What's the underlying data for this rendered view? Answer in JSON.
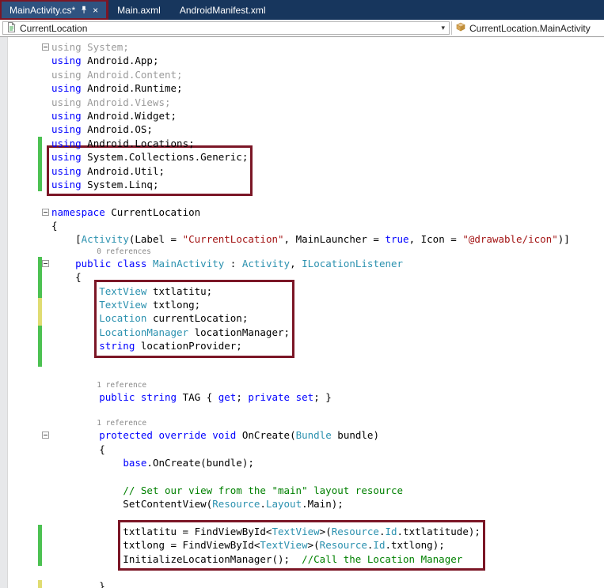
{
  "tabs": [
    {
      "label": "MainActivity.cs*",
      "active": true
    },
    {
      "label": "Main.axml",
      "active": false
    },
    {
      "label": "AndroidManifest.xml",
      "active": false
    }
  ],
  "navbar": {
    "scope": "CurrentLocation",
    "member": "CurrentLocation.MainActivity"
  },
  "colors": {
    "keyword": "#0000ff",
    "type": "#2b91af",
    "string": "#a31515",
    "comment": "#008000",
    "inactive_using": "#9b9b9b",
    "codelens": "#8a8a8a",
    "annotation_box": "#7b1626",
    "change_saved_green": "#4cc152",
    "change_unsaved_yellow": "#e0dc72",
    "tabbar_bg": "#17365d",
    "active_tab_bg": "#2f5380"
  },
  "icons": {
    "pin": "pin-icon",
    "close": "close-icon",
    "chevron": "chevron-down-icon",
    "document": "document-icon",
    "class": "class-icon"
  },
  "editor": {
    "box_groups": {
      "1": {
        "indent": 0
      },
      "2": {
        "indent": 8
      },
      "3": {
        "indent": 12
      }
    },
    "lines": [
      {
        "fold": true,
        "seg": [
          [
            "gy",
            "using System;"
          ]
        ]
      },
      {
        "seg": [
          [
            "kw",
            "using"
          ],
          [
            "pl",
            " Android.App;"
          ]
        ]
      },
      {
        "seg": [
          [
            "gy",
            "using Android.Content;"
          ]
        ]
      },
      {
        "seg": [
          [
            "kw",
            "using"
          ],
          [
            "pl",
            " Android.Runtime;"
          ]
        ]
      },
      {
        "seg": [
          [
            "gy",
            "using Android.Views;"
          ]
        ]
      },
      {
        "seg": [
          [
            "kw",
            "using"
          ],
          [
            "pl",
            " Android.Widget;"
          ]
        ]
      },
      {
        "seg": [
          [
            "kw",
            "using"
          ],
          [
            "pl",
            " Android.OS;"
          ]
        ]
      },
      {
        "cb": "g",
        "seg": [
          [
            "kw",
            "using"
          ],
          [
            "pl",
            " Android.Locations;"
          ]
        ]
      },
      {
        "cb": "g",
        "box": 1,
        "seg": [
          [
            "kw",
            "using"
          ],
          [
            "pl",
            " System.Collections.Generic;"
          ]
        ]
      },
      {
        "cb": "g",
        "box": 1,
        "seg": [
          [
            "kw",
            "using"
          ],
          [
            "pl",
            " Android.Util;"
          ]
        ]
      },
      {
        "cb": "g",
        "box": 1,
        "seg": [
          [
            "kw",
            "using"
          ],
          [
            "pl",
            " System.Linq;"
          ]
        ]
      },
      {
        "seg": []
      },
      {
        "fold": true,
        "seg": [
          [
            "kw",
            "namespace"
          ],
          [
            "pl",
            " CurrentLocation"
          ]
        ]
      },
      {
        "seg": [
          [
            "pl",
            "{"
          ]
        ]
      },
      {
        "seg": [
          [
            "pl",
            "    ["
          ],
          [
            "ty",
            "Activity"
          ],
          [
            "pl",
            "(Label = "
          ],
          [
            "st",
            "\"CurrentLocation\""
          ],
          [
            "pl",
            ", MainLauncher = "
          ],
          [
            "kw",
            "true"
          ],
          [
            "pl",
            ", Icon = "
          ],
          [
            "st",
            "\"@drawable/icon\""
          ],
          [
            "pl",
            ")]"
          ]
        ]
      },
      {
        "cl": true,
        "seg": [
          [
            "cl",
            "          0 references"
          ]
        ]
      },
      {
        "cb": "g",
        "fold": true,
        "seg": [
          [
            "pl",
            "    "
          ],
          [
            "kw",
            "public"
          ],
          [
            "pl",
            " "
          ],
          [
            "kw",
            "class"
          ],
          [
            "pl",
            " "
          ],
          [
            "ty",
            "MainActivity"
          ],
          [
            "pl",
            " : "
          ],
          [
            "ty",
            "Activity"
          ],
          [
            "pl",
            ", "
          ],
          [
            "ty",
            "ILocationListener"
          ]
        ]
      },
      {
        "cb": "g",
        "seg": [
          [
            "pl",
            "    {"
          ]
        ]
      },
      {
        "cb": "g",
        "box": 2,
        "seg": [
          [
            "ty",
            "TextView"
          ],
          [
            "pl",
            " txtlatitu;"
          ]
        ]
      },
      {
        "cb": "y",
        "box": 2,
        "seg": [
          [
            "ty",
            "TextView"
          ],
          [
            "pl",
            " txtlong;"
          ]
        ]
      },
      {
        "cb": "y",
        "box": 2,
        "seg": [
          [
            "ty",
            "Location"
          ],
          [
            "pl",
            " currentLocation;"
          ]
        ]
      },
      {
        "cb": "g",
        "box": 2,
        "seg": [
          [
            "ty",
            "LocationManager"
          ],
          [
            "pl",
            " locationManager;"
          ]
        ]
      },
      {
        "cb": "g",
        "box": 2,
        "seg": [
          [
            "kw",
            "string"
          ],
          [
            "pl",
            " locationProvider;"
          ]
        ]
      },
      {
        "cb": "g",
        "seg": []
      },
      {
        "seg": []
      },
      {
        "cl": true,
        "seg": [
          [
            "cl",
            "          1 reference"
          ]
        ]
      },
      {
        "seg": [
          [
            "pl",
            "        "
          ],
          [
            "kw",
            "public"
          ],
          [
            "pl",
            " "
          ],
          [
            "kw",
            "string"
          ],
          [
            "pl",
            " TAG { "
          ],
          [
            "kw",
            "get"
          ],
          [
            "pl",
            "; "
          ],
          [
            "kw",
            "private"
          ],
          [
            "pl",
            " "
          ],
          [
            "kw",
            "set"
          ],
          [
            "pl",
            "; }"
          ]
        ]
      },
      {
        "seg": []
      },
      {
        "cl": true,
        "seg": [
          [
            "cl",
            "          1 reference"
          ]
        ]
      },
      {
        "fold": true,
        "seg": [
          [
            "pl",
            "        "
          ],
          [
            "kw",
            "protected"
          ],
          [
            "pl",
            " "
          ],
          [
            "kw",
            "override"
          ],
          [
            "pl",
            " "
          ],
          [
            "kw",
            "void"
          ],
          [
            "pl",
            " OnCreate("
          ],
          [
            "ty",
            "Bundle"
          ],
          [
            "pl",
            " bundle)"
          ]
        ]
      },
      {
        "seg": [
          [
            "pl",
            "        {"
          ]
        ]
      },
      {
        "seg": [
          [
            "pl",
            "            "
          ],
          [
            "kw",
            "base"
          ],
          [
            "pl",
            ".OnCreate(bundle);"
          ]
        ]
      },
      {
        "seg": []
      },
      {
        "seg": [
          [
            "pl",
            "            "
          ],
          [
            "cm",
            "// Set our view from the \"main\" layout resource"
          ]
        ]
      },
      {
        "seg": [
          [
            "pl",
            "            SetContentView("
          ],
          [
            "ty",
            "Resource"
          ],
          [
            "pl",
            "."
          ],
          [
            "ty",
            "Layout"
          ],
          [
            "pl",
            ".Main);"
          ]
        ]
      },
      {
        "seg": []
      },
      {
        "cb": "g",
        "box": 3,
        "seg": [
          [
            "pl",
            "txtlatitu = FindViewById<"
          ],
          [
            "ty",
            "TextView"
          ],
          [
            "pl",
            ">("
          ],
          [
            "ty",
            "Resource"
          ],
          [
            "pl",
            "."
          ],
          [
            "ty",
            "Id"
          ],
          [
            "pl",
            ".txtlatitude);"
          ]
        ]
      },
      {
        "cb": "g",
        "box": 3,
        "seg": [
          [
            "pl",
            "txtlong = FindViewById<"
          ],
          [
            "ty",
            "TextView"
          ],
          [
            "pl",
            ">("
          ],
          [
            "ty",
            "Resource"
          ],
          [
            "pl",
            "."
          ],
          [
            "ty",
            "Id"
          ],
          [
            "pl",
            ".txtlong);"
          ]
        ]
      },
      {
        "cb": "g",
        "box": 3,
        "seg": [
          [
            "pl",
            "InitializeLocationManager();  "
          ],
          [
            "cm",
            "//Call the Location Manager"
          ]
        ]
      },
      {
        "seg": []
      },
      {
        "cb": "y",
        "seg": [
          [
            "pl",
            "        }"
          ]
        ]
      }
    ]
  }
}
